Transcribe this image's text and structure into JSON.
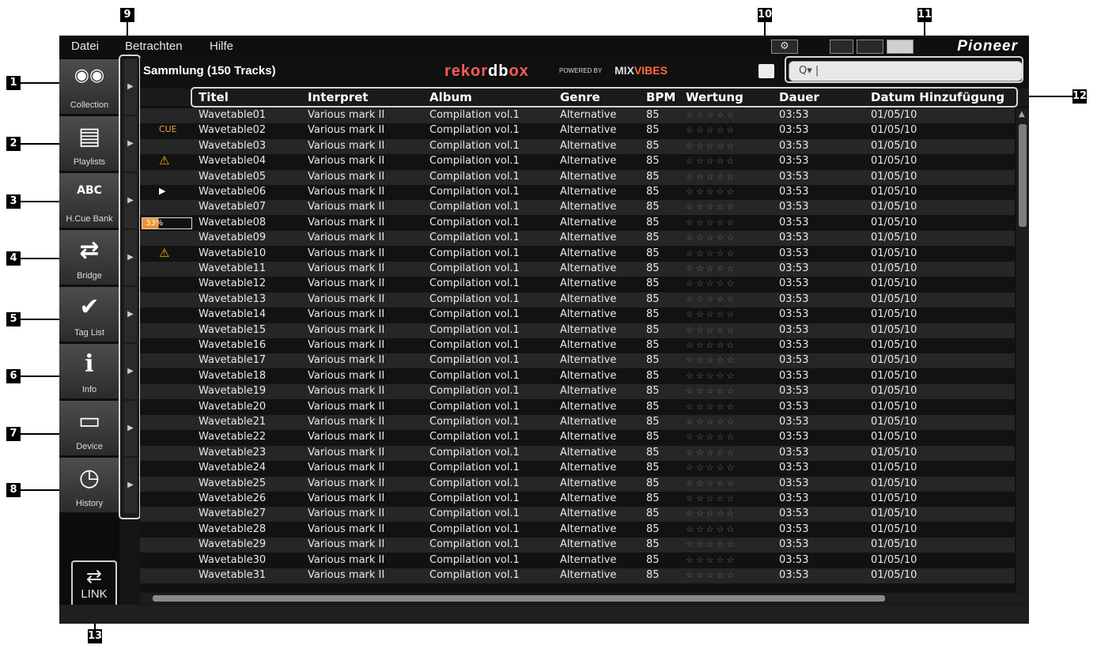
{
  "menu": [
    "Datei",
    "Betrachten",
    "Hilfe"
  ],
  "brand": "Pioneer",
  "collection_title": "Sammlung (150 Tracks)",
  "logo": {
    "rekord": "rekor",
    "db": "db",
    "ox": "ox",
    "powered": "POWERED BY",
    "mixvibes_a": "MIX",
    "mixvibes_b": "VIBES"
  },
  "search": {
    "value": "Q▾ |"
  },
  "sidebar": [
    {
      "label": "Collection",
      "glyph": "◉◉"
    },
    {
      "label": "Playlists",
      "glyph": "▤"
    },
    {
      "label": "H.Cue Bank",
      "glyph": "ABC"
    },
    {
      "label": "Bridge",
      "glyph": "⇄"
    },
    {
      "label": "Tag List",
      "glyph": "✔"
    },
    {
      "label": "Info",
      "glyph": "i"
    },
    {
      "label": "Device",
      "glyph": "▭"
    },
    {
      "label": "History",
      "glyph": "◷"
    }
  ],
  "link": {
    "arrows": "⇄",
    "label": "LINK"
  },
  "columns": [
    "Titel",
    "Interpret",
    "Album",
    "Genre",
    "BPM",
    "Wertung",
    "Dauer",
    "Datum Hinzufügung"
  ],
  "rows": [
    {
      "mark": "",
      "title": "Wavetable01",
      "artist": "Various mark II",
      "album": "Compilation vol.1",
      "genre": "Alternative",
      "bpm": "85",
      "rating": "☆☆☆☆☆",
      "time": "03:53",
      "date": "01/05/10"
    },
    {
      "mark": "CUE",
      "title": "Wavetable02",
      "artist": "Various mark II",
      "album": "Compilation vol.1",
      "genre": "Alternative",
      "bpm": "85",
      "rating": "☆☆☆☆☆",
      "time": "03:53",
      "date": "01/05/10"
    },
    {
      "mark": "",
      "title": "Wavetable03",
      "artist": "Various mark II",
      "album": "Compilation vol.1",
      "genre": "Alternative",
      "bpm": "85",
      "rating": "☆☆☆☆☆",
      "time": "03:53",
      "date": "01/05/10"
    },
    {
      "mark": "⚠",
      "title": "Wavetable04",
      "artist": "Various mark II",
      "album": "Compilation vol.1",
      "genre": "Alternative",
      "bpm": "85",
      "rating": "☆☆☆☆☆",
      "time": "03:53",
      "date": "01/05/10"
    },
    {
      "mark": "",
      "title": "Wavetable05",
      "artist": "Various mark II",
      "album": "Compilation vol.1",
      "genre": "Alternative",
      "bpm": "85",
      "rating": "☆☆☆☆☆",
      "time": "03:53",
      "date": "01/05/10"
    },
    {
      "mark": "▶",
      "title": "Wavetable06",
      "artist": "Various mark II",
      "album": "Compilation vol.1",
      "genre": "Alternative",
      "bpm": "85",
      "rating": "☆☆☆☆☆",
      "time": "03:53",
      "date": "01/05/10"
    },
    {
      "mark": "",
      "title": "Wavetable07",
      "artist": "Various mark II",
      "album": "Compilation vol.1",
      "genre": "Alternative",
      "bpm": "85",
      "rating": "☆☆☆☆☆",
      "time": "03:53",
      "date": "01/05/10"
    },
    {
      "mark": "33%",
      "title": "Wavetable08",
      "artist": "Various mark II",
      "album": "Compilation vol.1",
      "genre": "Alternative",
      "bpm": "85",
      "rating": "☆☆☆☆☆",
      "time": "03:53",
      "date": "01/05/10"
    },
    {
      "mark": "",
      "title": "Wavetable09",
      "artist": "Various mark II",
      "album": "Compilation vol.1",
      "genre": "Alternative",
      "bpm": "85",
      "rating": "☆☆☆☆☆",
      "time": "03:53",
      "date": "01/05/10"
    },
    {
      "mark": "⚠",
      "title": "Wavetable10",
      "artist": "Various mark II",
      "album": "Compilation vol.1",
      "genre": "Alternative",
      "bpm": "85",
      "rating": "☆☆☆☆☆",
      "time": "03:53",
      "date": "01/05/10"
    },
    {
      "mark": "",
      "title": "Wavetable11",
      "artist": "Various mark II",
      "album": "Compilation vol.1",
      "genre": "Alternative",
      "bpm": "85",
      "rating": "☆☆☆☆☆",
      "time": "03:53",
      "date": "01/05/10"
    },
    {
      "mark": "",
      "title": "Wavetable12",
      "artist": "Various mark II",
      "album": "Compilation vol.1",
      "genre": "Alternative",
      "bpm": "85",
      "rating": "☆☆☆☆☆",
      "time": "03:53",
      "date": "01/05/10"
    },
    {
      "mark": "",
      "title": "Wavetable13",
      "artist": "Various mark II",
      "album": "Compilation vol.1",
      "genre": "Alternative",
      "bpm": "85",
      "rating": "☆☆☆☆☆",
      "time": "03:53",
      "date": "01/05/10"
    },
    {
      "mark": "",
      "title": "Wavetable14",
      "artist": "Various mark II",
      "album": "Compilation vol.1",
      "genre": "Alternative",
      "bpm": "85",
      "rating": "☆☆☆☆☆",
      "time": "03:53",
      "date": "01/05/10"
    },
    {
      "mark": "",
      "title": "Wavetable15",
      "artist": "Various mark II",
      "album": "Compilation vol.1",
      "genre": "Alternative",
      "bpm": "85",
      "rating": "☆☆☆☆☆",
      "time": "03:53",
      "date": "01/05/10"
    },
    {
      "mark": "",
      "title": "Wavetable16",
      "artist": "Various mark II",
      "album": "Compilation vol.1",
      "genre": "Alternative",
      "bpm": "85",
      "rating": "☆☆☆☆☆",
      "time": "03:53",
      "date": "01/05/10"
    },
    {
      "mark": "",
      "title": "Wavetable17",
      "artist": "Various mark II",
      "album": "Compilation vol.1",
      "genre": "Alternative",
      "bpm": "85",
      "rating": "☆☆☆☆☆",
      "time": "03:53",
      "date": "01/05/10"
    },
    {
      "mark": "",
      "title": "Wavetable18",
      "artist": "Various mark II",
      "album": "Compilation vol.1",
      "genre": "Alternative",
      "bpm": "85",
      "rating": "☆☆☆☆☆",
      "time": "03:53",
      "date": "01/05/10"
    },
    {
      "mark": "",
      "title": "Wavetable19",
      "artist": "Various mark II",
      "album": "Compilation vol.1",
      "genre": "Alternative",
      "bpm": "85",
      "rating": "☆☆☆☆☆",
      "time": "03:53",
      "date": "01/05/10"
    },
    {
      "mark": "",
      "title": "Wavetable20",
      "artist": "Various mark II",
      "album": "Compilation vol.1",
      "genre": "Alternative",
      "bpm": "85",
      "rating": "☆☆☆☆☆",
      "time": "03:53",
      "date": "01/05/10"
    },
    {
      "mark": "",
      "title": "Wavetable21",
      "artist": "Various mark II",
      "album": "Compilation vol.1",
      "genre": "Alternative",
      "bpm": "85",
      "rating": "☆☆☆☆☆",
      "time": "03:53",
      "date": "01/05/10"
    },
    {
      "mark": "",
      "title": "Wavetable22",
      "artist": "Various mark II",
      "album": "Compilation vol.1",
      "genre": "Alternative",
      "bpm": "85",
      "rating": "☆☆☆☆☆",
      "time": "03:53",
      "date": "01/05/10"
    },
    {
      "mark": "",
      "title": "Wavetable23",
      "artist": "Various mark II",
      "album": "Compilation vol.1",
      "genre": "Alternative",
      "bpm": "85",
      "rating": "☆☆☆☆☆",
      "time": "03:53",
      "date": "01/05/10"
    },
    {
      "mark": "",
      "title": "Wavetable24",
      "artist": "Various mark II",
      "album": "Compilation vol.1",
      "genre": "Alternative",
      "bpm": "85",
      "rating": "☆☆☆☆☆",
      "time": "03:53",
      "date": "01/05/10"
    },
    {
      "mark": "",
      "title": "Wavetable25",
      "artist": "Various mark II",
      "album": "Compilation vol.1",
      "genre": "Alternative",
      "bpm": "85",
      "rating": "☆☆☆☆☆",
      "time": "03:53",
      "date": "01/05/10"
    },
    {
      "mark": "",
      "title": "Wavetable26",
      "artist": "Various mark II",
      "album": "Compilation vol.1",
      "genre": "Alternative",
      "bpm": "85",
      "rating": "☆☆☆☆☆",
      "time": "03:53",
      "date": "01/05/10"
    },
    {
      "mark": "",
      "title": "Wavetable27",
      "artist": "Various mark II",
      "album": "Compilation vol.1",
      "genre": "Alternative",
      "bpm": "85",
      "rating": "☆☆☆☆☆",
      "time": "03:53",
      "date": "01/05/10"
    },
    {
      "mark": "",
      "title": "Wavetable28",
      "artist": "Various mark II",
      "album": "Compilation vol.1",
      "genre": "Alternative",
      "bpm": "85",
      "rating": "☆☆☆☆☆",
      "time": "03:53",
      "date": "01/05/10"
    },
    {
      "mark": "",
      "title": "Wavetable29",
      "artist": "Various mark II",
      "album": "Compilation vol.1",
      "genre": "Alternative",
      "bpm": "85",
      "rating": "☆☆☆☆☆",
      "time": "03:53",
      "date": "01/05/10"
    },
    {
      "mark": "",
      "title": "Wavetable30",
      "artist": "Various mark II",
      "album": "Compilation vol.1",
      "genre": "Alternative",
      "bpm": "85",
      "rating": "☆☆☆☆☆",
      "time": "03:53",
      "date": "01/05/10"
    },
    {
      "mark": "",
      "title": "Wavetable31",
      "artist": "Various mark II",
      "album": "Compilation vol.1",
      "genre": "Alternative",
      "bpm": "85",
      "rating": "☆☆☆☆☆",
      "time": "03:53",
      "date": "01/05/10"
    }
  ],
  "callouts": [
    "1",
    "2",
    "3",
    "4",
    "5",
    "6",
    "7",
    "8",
    "9",
    "10",
    "11",
    "12",
    "13"
  ],
  "colors": {
    "accent": "#ff5a5a",
    "warning": "#f5b800",
    "cue": "#e8a23c",
    "progress": "#f0902a"
  }
}
